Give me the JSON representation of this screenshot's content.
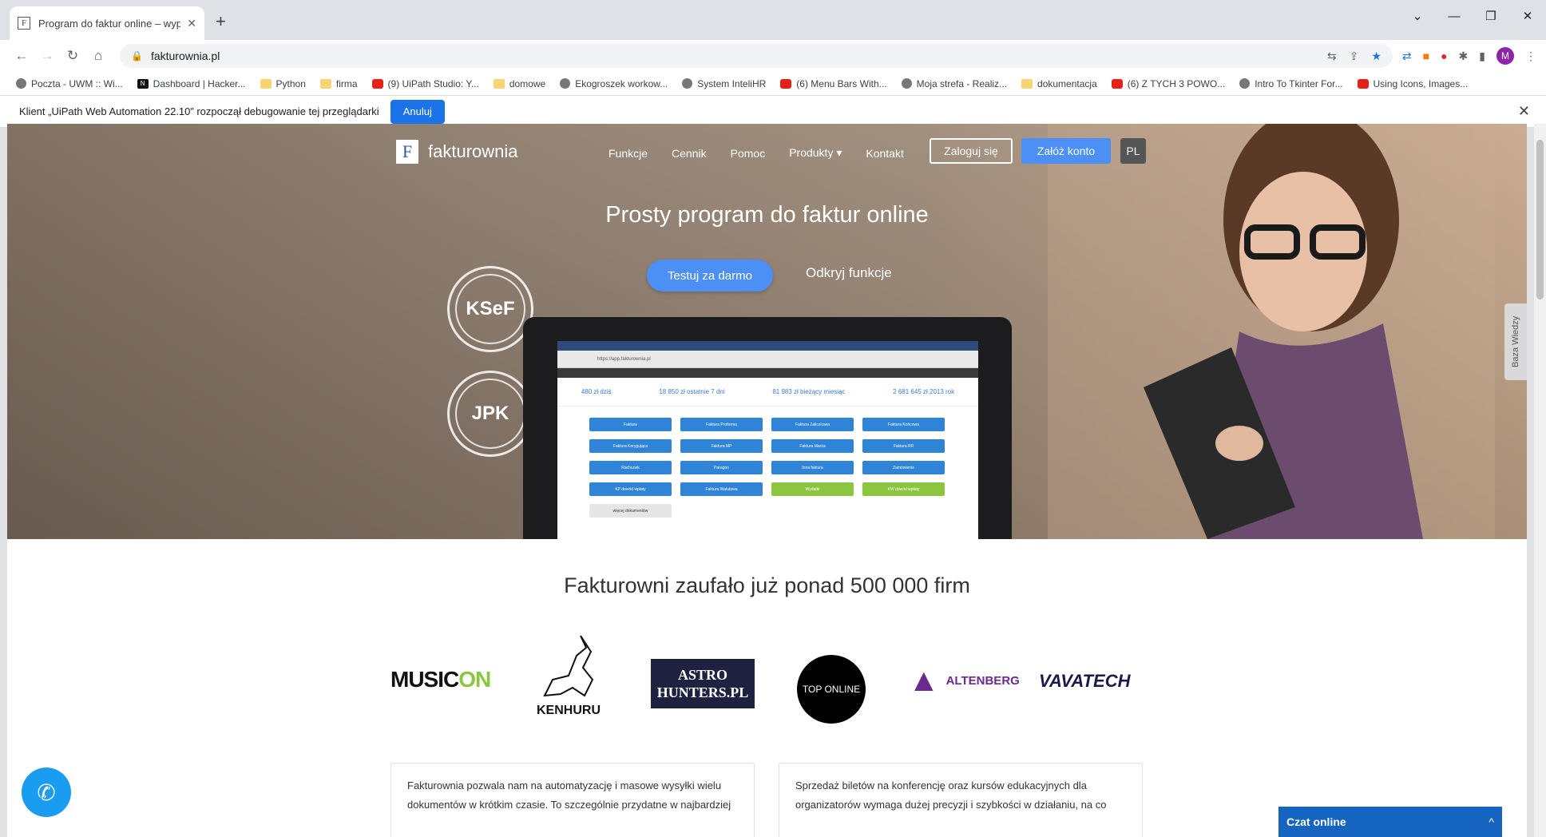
{
  "browser": {
    "tab_title": "Program do faktur online – wyp",
    "tab_close": "✕",
    "new_tab": "+",
    "window_controls": [
      "⌄",
      "—",
      "❐",
      "✕"
    ],
    "url": "fakturownia.pl",
    "avatar_letter": "M"
  },
  "bookmarks": [
    {
      "label": "Poczta - UWM :: Wi...",
      "icon": "glob"
    },
    {
      "label": "Dashboard | Hacker...",
      "icon": "hn"
    },
    {
      "label": "Python",
      "icon": "fold"
    },
    {
      "label": "firma",
      "icon": "fold"
    },
    {
      "label": "(9) UiPath Studio: Y...",
      "icon": "yt"
    },
    {
      "label": "domowe",
      "icon": "fold"
    },
    {
      "label": "Ekogroszek workow...",
      "icon": "glob"
    },
    {
      "label": "System InteliHR",
      "icon": "glob"
    },
    {
      "label": "(6) Menu Bars With...",
      "icon": "yt"
    },
    {
      "label": "Moja strefa - Realiz...",
      "icon": "glob"
    },
    {
      "label": "dokumentacja",
      "icon": "fold"
    },
    {
      "label": "(6) Z TYCH 3 POWO...",
      "icon": "yt"
    },
    {
      "label": "Intro To Tkinter For...",
      "icon": "glob"
    },
    {
      "label": "Using Icons, Images...",
      "icon": "yt"
    }
  ],
  "infobar": {
    "message": "Klient „UiPath Web Automation 22.10” rozpoczął debugowanie tej przeglądarki",
    "button": "Anuluj",
    "close": "✕"
  },
  "site": {
    "logo_letter": "F",
    "logo_text": "fakturownia",
    "nav": [
      "Funkcje",
      "Cennik",
      "Pomoc",
      "Produkty ▾",
      "Kontakt"
    ],
    "login": "Zaloguj się",
    "signup": "Załóż konto",
    "lang": "PL",
    "headline": "Prosty program do faktur online",
    "try_button": "Testuj za darmo",
    "discover_link": "Odkryj funkcje",
    "badge1": "KSeF",
    "badge2": "JPK",
    "side_tab": "Baza Wiedzy",
    "trust_heading": "Fakturowni zaufało już ponad 500 000 firm",
    "card1": "Fakturownia pozwala nam na automatyzację i masowe wysyłki wielu dokumentów w krótkim czasie. To szczególnie przydatne w najbardziej",
    "card2": "Sprzedaż biletów na konferencję oraz kursów edukacyjnych dla organizatorów wymaga dużej precyzji i szybkości w działaniu, na co",
    "chat_label": "Czat online",
    "chat_caret": "^"
  },
  "app_preview": {
    "url": "https://app.fakturownia.pl",
    "stats": [
      "480 zł dziś",
      "18 850 zł ostatnie 7 dni",
      "81 983 zł bieżący miesiąc",
      "2 681 645 zł 2013 rok"
    ],
    "buttons": [
      "Faktura",
      "Faktura Proforma",
      "Faktura Zaliczkowa",
      "Faktura Końcowa",
      "Faktura Korygująca",
      "Faktura MP",
      "Faktura Marża",
      "Faktura RR",
      "Rachunek",
      "Paragon",
      "Inna faktura",
      "Zamówienie",
      "KP dowód wpłaty",
      "Faktura Walutowa",
      "Wydatki",
      "KW dowód wpłaty",
      "więcej dokumentów"
    ]
  },
  "clients": {
    "musicon_a": "MUSIC",
    "musicon_b": "ON",
    "kenhuru": "KENHURU",
    "astro_1": "ASTRO",
    "astro_2": "HUNTERS.PL",
    "toponline": "TOP ONLINE",
    "altenberg": "ALTENBERG",
    "vavatech": "VAVATECH"
  }
}
